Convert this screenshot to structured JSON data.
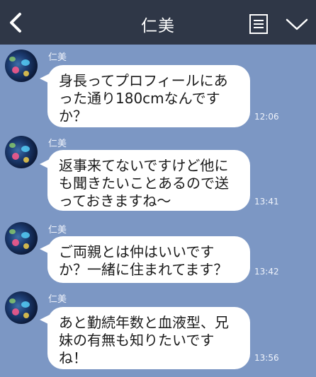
{
  "header": {
    "title": "仁美",
    "bg_color": "#2f3747",
    "back_icon": "chevron-left-icon",
    "memo_icon": "note-icon",
    "menu_icon": "chevron-down-icon"
  },
  "chat_bg_color": "#7c97c4",
  "messages": [
    {
      "sender": "仁美",
      "text": "身長ってプロフィールにあった通り180cmなんですか？",
      "time": "12:06"
    },
    {
      "sender": "仁美",
      "text": "返事来てないですけど他にも聞きたいことあるので送っておきますね～",
      "time": "13:41"
    },
    {
      "sender": "仁美",
      "text": "ご両親とは仲はいいですか？一緒に住まれてます？",
      "time": "13:42"
    },
    {
      "sender": "仁美",
      "text": "あと勤続年数と血液型、兄妹の有無も知りたいですね！",
      "time": "13:56"
    }
  ]
}
